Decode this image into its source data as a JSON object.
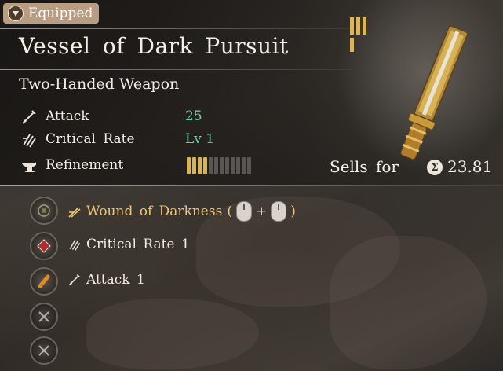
{
  "status_badge": "Equipped",
  "item": {
    "name": "Vessel of Dark Pursuit",
    "type": "Two-Handed Weapon"
  },
  "stats": [
    {
      "label": "Attack",
      "value": "25",
      "icon": "sword-icon"
    },
    {
      "label": "Critical Rate",
      "value": "Lv 1",
      "icon": "critical-claw-icon"
    },
    {
      "label": "Refinement",
      "icon": "anvil-icon",
      "filled": 4,
      "total": 12
    }
  ],
  "sell": {
    "label": "Sells for",
    "price": "23.81",
    "currency_icon": "coin-icon"
  },
  "skills": [
    {
      "name": "Wound of Darkness",
      "open": "(",
      "plus": "+",
      "close": ")",
      "icon": "sword-slash-icon",
      "highlight": true
    },
    {
      "name": "Critical Rate 1",
      "icon": "critical-claw-icon"
    },
    {
      "name": "Attack 1",
      "icon": "sword-icon"
    }
  ],
  "colors": {
    "value_green": "#63d4a0",
    "skill_gold": "#f0c474",
    "badge": "#b89d83",
    "refine_on": "#d6b454"
  }
}
